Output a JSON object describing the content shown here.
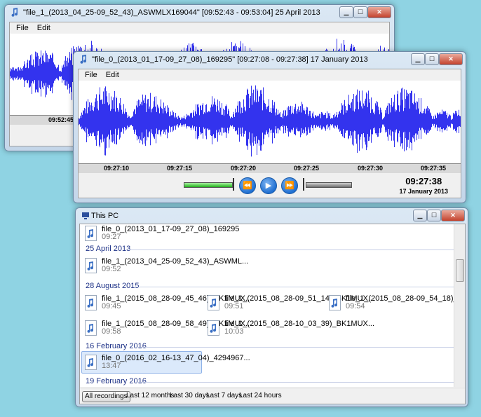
{
  "window1": {
    "title": "\"file_1_(2013_04_25-09_52_43)_ASWMLX169044\" [09:52:43 - 09:53:04] 25 April 2013",
    "menu": [
      "File",
      "Edit"
    ],
    "timeline_ticks": [
      "09:52:45"
    ]
  },
  "window2": {
    "title": "\"file_0_(2013_01_17-09_27_08)_169295\" [09:27:08 - 09:27:38] 17 January 2013",
    "menu": [
      "File",
      "Edit"
    ],
    "timeline_ticks": [
      "09:27:10",
      "09:27:15",
      "09:27:20",
      "09:27:25",
      "09:27:30",
      "09:27:35"
    ],
    "clock_time": "09:27:38",
    "clock_date": "17 January 2013",
    "playback_progress": 0.37,
    "waveform_color": "#3333ee",
    "controls": {
      "rewind": "⏪",
      "play": "▶",
      "forward": "⏩"
    }
  },
  "explorer": {
    "title": "This PC",
    "top_item": {
      "name": "file_0_(2013_01_17-09_27_08)_169295",
      "time": "09:27"
    },
    "groups": [
      {
        "label": "25 April 2013",
        "items": [
          {
            "name": "file_1_(2013_04_25-09_52_43)_ASWML...",
            "time": "09:52"
          }
        ]
      },
      {
        "label": "28 August 2015",
        "items": [
          {
            "name": "file_1_(2015_08_28-09_45_46)_BK1MUX...",
            "time": "09:45"
          },
          {
            "name": "file_1_(2015_08_28-09_51_14)_BK1MUX...",
            "time": "09:51"
          },
          {
            "name": "file_1_(2015_08_28-09_54_18)_BK1MUX...",
            "time": "09:54"
          },
          {
            "name": "file_1_(2015_08_28-09_58_49)_BK1MUX...",
            "time": "09:58"
          },
          {
            "name": "file_1_(2015_08_28-10_03_39)_BK1MUX...",
            "time": "10:03"
          }
        ]
      },
      {
        "label": "16 February 2016",
        "items": [
          {
            "name": "file_0_(2016_02_16-13_47_04)_4294967...",
            "time": "13:47",
            "selected": true
          }
        ]
      },
      {
        "label": "19 February 2016",
        "items": []
      }
    ],
    "filters": [
      "All recordings",
      "Last 12 months",
      "Last 30 days",
      "Last 7 days",
      "Last 24 hours"
    ],
    "active_filter": "All recordings"
  },
  "window_buttons": {
    "minimize": "▁",
    "maximize": "☐",
    "close": "✕"
  }
}
